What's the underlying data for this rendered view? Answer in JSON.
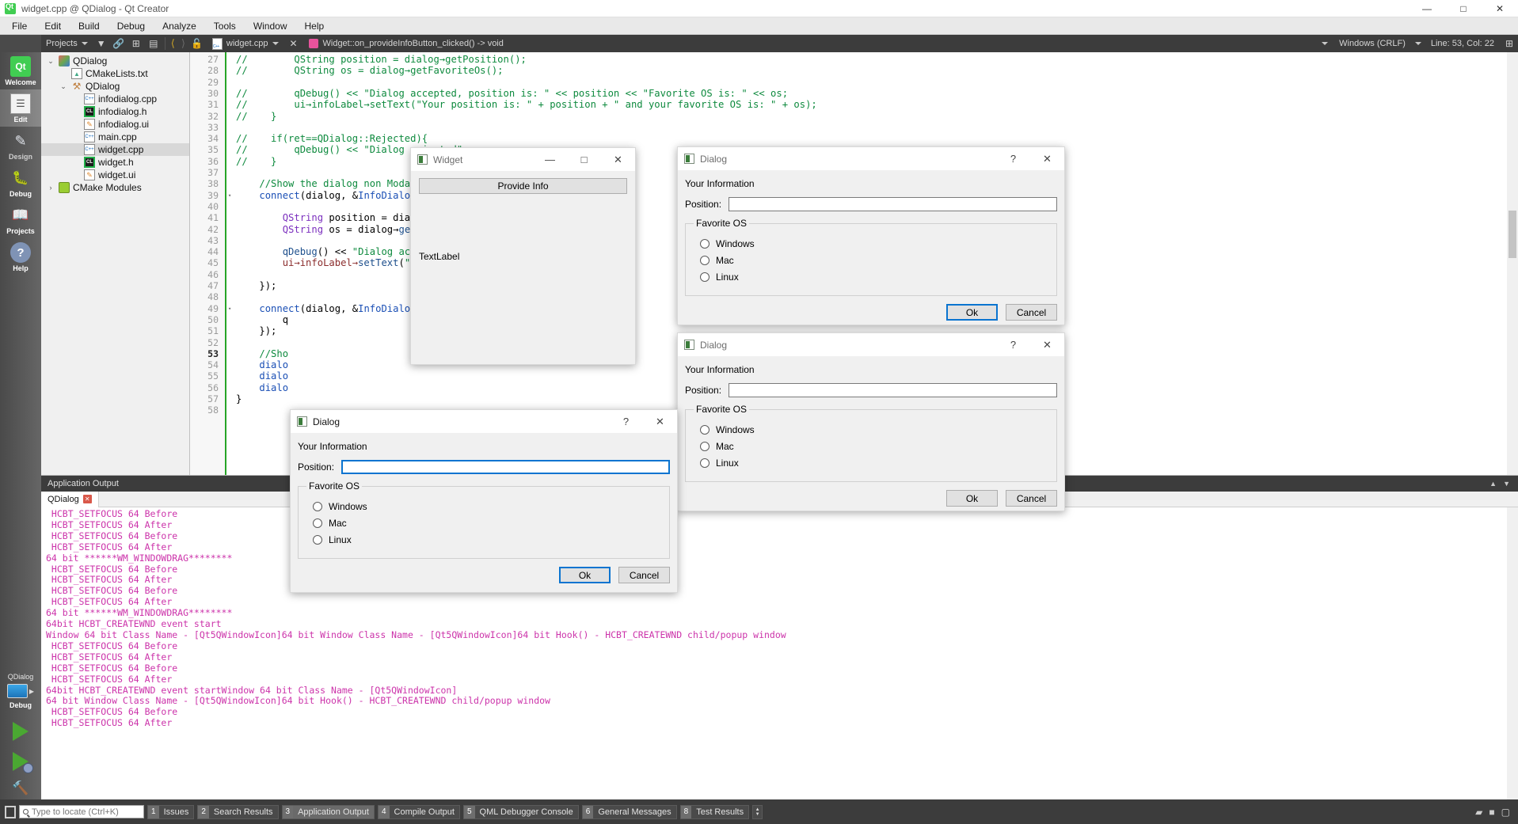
{
  "titlebar": {
    "title": "widget.cpp @ QDialog - Qt Creator",
    "minimize": "—",
    "maximize": "□",
    "close": "✕"
  },
  "menubar": {
    "items": [
      "File",
      "Edit",
      "Build",
      "Debug",
      "Analyze",
      "Tools",
      "Window",
      "Help"
    ]
  },
  "toolbar": {
    "project_selector": "Projects",
    "file_name": "widget.cpp",
    "function_symbol": "Widget::on_provideInfoButton_clicked() -> void",
    "line_ending": "Windows (CRLF)",
    "cursor_position": "Line: 53, Col: 22",
    "close_tab": "✕"
  },
  "modes": [
    {
      "label": "Welcome",
      "icon": "qt-logo-icon"
    },
    {
      "label": "Edit",
      "icon": "document-edit-icon"
    },
    {
      "label": "Design",
      "icon": "design-tools-icon"
    },
    {
      "label": "Debug",
      "icon": "bug-icon"
    },
    {
      "label": "Projects",
      "icon": "folder-projects-icon"
    },
    {
      "label": "Help",
      "icon": "question-circle-icon"
    }
  ],
  "runbar": {
    "kit": "QDialog",
    "build_config": "Debug",
    "run": "run-icon",
    "debug": "debug-run-icon",
    "build": "hammer-icon"
  },
  "tree": [
    {
      "label": "QDialog",
      "indent": 0,
      "twist": "⌄",
      "icon": "project-icon",
      "sel": false
    },
    {
      "label": "CMakeLists.txt",
      "indent": 1,
      "twist": "",
      "icon": "cmake-file-icon",
      "sel": false
    },
    {
      "label": "QDialog",
      "indent": 1,
      "twist": "⌄",
      "icon": "build-target-icon",
      "sel": false
    },
    {
      "label": "infodialog.cpp",
      "indent": 2,
      "twist": "",
      "icon": "cpp-file-icon",
      "sel": false
    },
    {
      "label": "infodialog.h",
      "indent": 2,
      "twist": "",
      "icon": "header-file-icon",
      "sel": false
    },
    {
      "label": "infodialog.ui",
      "indent": 2,
      "twist": "",
      "icon": "ui-file-icon",
      "sel": false
    },
    {
      "label": "main.cpp",
      "indent": 2,
      "twist": "",
      "icon": "cpp-file-icon",
      "sel": false
    },
    {
      "label": "widget.cpp",
      "indent": 2,
      "twist": "",
      "icon": "cpp-file-icon",
      "sel": true
    },
    {
      "label": "widget.h",
      "indent": 2,
      "twist": "",
      "icon": "header-file-icon",
      "sel": false
    },
    {
      "label": "widget.ui",
      "indent": 2,
      "twist": "",
      "icon": "ui-file-icon",
      "sel": false
    },
    {
      "label": "CMake Modules",
      "indent": 0,
      "twist": "›",
      "icon": "cmake-modules-icon",
      "sel": false
    }
  ],
  "code": {
    "first_line": 27,
    "current_line": 53,
    "lines": [
      {
        "n": 27,
        "fold": "",
        "html": "<span class='c-cmt'>//        QString position = dialog→getPosition();</span>"
      },
      {
        "n": 28,
        "fold": "",
        "html": "<span class='c-cmt'>//        QString os = dialog→getFavoriteOs();</span>"
      },
      {
        "n": 29,
        "fold": "",
        "html": ""
      },
      {
        "n": 30,
        "fold": "",
        "html": "<span class='c-cmt'>//        qDebug() &lt;&lt; \"Dialog accepted, position is: \" &lt;&lt; position &lt;&lt; \"Favorite OS is: \" &lt;&lt; os;</span>"
      },
      {
        "n": 31,
        "fold": "",
        "html": "<span class='c-cmt'>//        ui→infoLabel→setText(\"Your position is: \" + position + \" and your favorite OS is: \" + os);</span>"
      },
      {
        "n": 32,
        "fold": "",
        "html": "<span class='c-cmt'>//    }</span>"
      },
      {
        "n": 33,
        "fold": "",
        "html": ""
      },
      {
        "n": 34,
        "fold": "",
        "html": "<span class='c-cmt'>//    if(ret==QDialog::Rejected){</span>"
      },
      {
        "n": 35,
        "fold": "",
        "html": "<span class='c-cmt'>//        qDebug() &lt;&lt; \"Dialog rejected\";</span>"
      },
      {
        "n": 36,
        "fold": "",
        "html": "<span class='c-cmt'>//    }</span>"
      },
      {
        "n": 37,
        "fold": "",
        "html": ""
      },
      {
        "n": 38,
        "fold": "",
        "html": "    <span class='c-cmt'>//Show the dialog non Modal</span>"
      },
      {
        "n": 39,
        "fold": "▾",
        "html": "    <span class='c-typ'>connect</span><span class='c-dark'>(dialog, &amp;</span><span class='c-typ'>InfoDialog</span><span class='c-dark'>::a</span>"
      },
      {
        "n": 40,
        "fold": "",
        "html": ""
      },
      {
        "n": 41,
        "fold": "",
        "html": "        <span class='c-kw'>QString</span> <span class='c-dark'>position = dialog→</span>"
      },
      {
        "n": 42,
        "fold": "",
        "html": "        <span class='c-kw'>QString</span> <span class='c-dark'>os = dialog→</span><span class='c-fn'>getFav</span>"
      },
      {
        "n": 43,
        "fold": "",
        "html": ""
      },
      {
        "n": 44,
        "fold": "",
        "html": "        <span class='c-fn'>qDebug</span><span class='c-dark'>() &lt;&lt; </span><span class='c-str'>\"Dialog accepte</span>"
      },
      {
        "n": 45,
        "fold": "",
        "html": "        <span class='c-mem'>ui→infoLabel→</span><span class='c-fn'>setText</span><span class='c-dark'>(</span><span class='c-str'>\"You</span>"
      },
      {
        "n": 46,
        "fold": "",
        "html": ""
      },
      {
        "n": 47,
        "fold": "",
        "html": "    <span class='c-dark'>});</span>"
      },
      {
        "n": 48,
        "fold": "",
        "html": ""
      },
      {
        "n": 49,
        "fold": "▾",
        "html": "    <span class='c-typ'>connect</span><span class='c-dark'>(dialog, &amp;</span><span class='c-typ'>InfoDialog</span><span class='c-dark'>::rejected, [=](){</span>"
      },
      {
        "n": 50,
        "fold": "",
        "html": "        <span class='c-dark'>q</span>"
      },
      {
        "n": 51,
        "fold": "",
        "html": "    <span class='c-dark'>});</span>"
      },
      {
        "n": 52,
        "fold": "",
        "html": ""
      },
      {
        "n": 53,
        "fold": "",
        "html": "    <span class='c-cmt'>//Sho</span>"
      },
      {
        "n": 54,
        "fold": "",
        "html": "    <span class='c-typ'>dialo</span>"
      },
      {
        "n": 55,
        "fold": "",
        "html": "    <span class='c-typ'>dialo</span>"
      },
      {
        "n": 56,
        "fold": "",
        "html": "    <span class='c-typ'>dialo</span>"
      },
      {
        "n": 57,
        "fold": "",
        "html": "<span class='c-dark'>}</span>"
      },
      {
        "n": 58,
        "fold": "",
        "html": ""
      }
    ]
  },
  "output_panel": {
    "header": "Application Output",
    "tab_label": "QDialog",
    "tab_close": "✕",
    "lines": [
      " HCBT_SETFOCUS 64 Before",
      " HCBT_SETFOCUS 64 After",
      " HCBT_SETFOCUS 64 Before",
      " HCBT_SETFOCUS 64 After",
      "64 bit ******WM_WINDOWDRAG********",
      " HCBT_SETFOCUS 64 Before",
      " HCBT_SETFOCUS 64 After",
      " HCBT_SETFOCUS 64 Before",
      " HCBT_SETFOCUS 64 After",
      "64 bit ******WM_WINDOWDRAG********",
      "64bit HCBT_CREATEWND event start",
      "Window 64 bit Class Name - [Qt5QWindowIcon]64 bit Window Class Name - [Qt5QWindowIcon]64 bit Hook() - HCBT_CREATEWND child/popup window",
      " HCBT_SETFOCUS 64 Before",
      " HCBT_SETFOCUS 64 After",
      " HCBT_SETFOCUS 64 Before",
      " HCBT_SETFOCUS 64 After",
      "64bit HCBT_CREATEWND event startWindow 64 bit Class Name - [Qt5QWindowIcon]",
      "64 bit Window Class Name - [Qt5QWindowIcon]64 bit Hook() - HCBT_CREATEWND child/popup window",
      " HCBT_SETFOCUS 64 Before",
      " HCBT_SETFOCUS 64 After"
    ]
  },
  "statusbar": {
    "locator_placeholder": "Type to locate (Ctrl+K)",
    "buttons": [
      {
        "num": "1",
        "label": "Issues",
        "active": false
      },
      {
        "num": "2",
        "label": "Search Results",
        "active": false
      },
      {
        "num": "3",
        "label": "Application Output",
        "active": true
      },
      {
        "num": "4",
        "label": "Compile Output",
        "active": false
      },
      {
        "num": "5",
        "label": "QML Debugger Console",
        "active": false
      },
      {
        "num": "6",
        "label": "General Messages",
        "active": false
      },
      {
        "num": "8",
        "label": "Test Results",
        "active": false
      }
    ]
  },
  "widget_window": {
    "title": "Widget",
    "minimize": "—",
    "maximize": "□",
    "close": "✕",
    "button_label": "Provide Info",
    "text_label": "TextLabel"
  },
  "dialog_common": {
    "title": "Dialog",
    "help": "?",
    "close": "✕",
    "heading": "Your Information",
    "position_label": "Position:",
    "position_value": "",
    "group_label": "Favorite OS",
    "options": [
      "Windows",
      "Mac",
      "Linux"
    ],
    "ok": "Ok",
    "cancel": "Cancel"
  },
  "colors": {
    "accent_blue": "#0a74d0",
    "output_text": "#cc33aa",
    "comment_green": "#0e8a3e",
    "qt_green": "#41cd52"
  }
}
